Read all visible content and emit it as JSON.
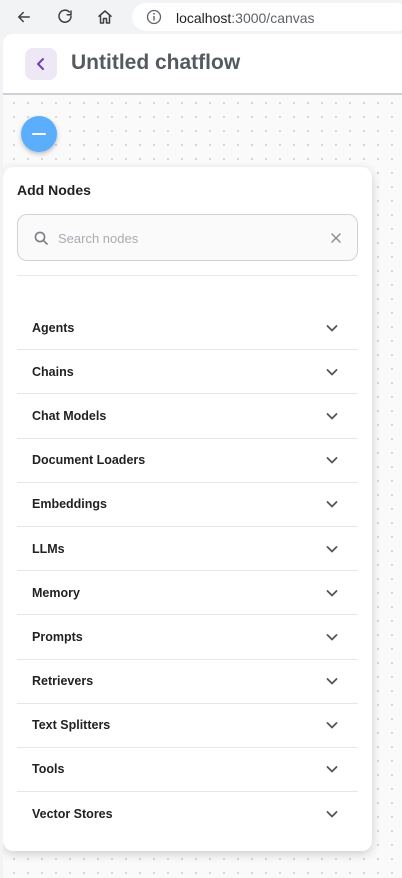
{
  "browser": {
    "url_host": "localhost",
    "url_path": ":3000/canvas"
  },
  "header": {
    "title": "Untitled chatflow"
  },
  "panel": {
    "title": "Add Nodes",
    "search_placeholder": "Search nodes",
    "search_value": "",
    "categories": [
      "Agents",
      "Chains",
      "Chat Models",
      "Document Loaders",
      "Embeddings",
      "LLMs",
      "Memory",
      "Prompts",
      "Retrievers",
      "Text Splitters",
      "Tools",
      "Vector Stores"
    ]
  },
  "icons": {
    "back": "arrow-left-icon",
    "reload": "reload-icon",
    "home": "home-icon",
    "info": "info-icon",
    "chatflow_back": "chevron-left-icon",
    "toggle": "minus-icon",
    "search": "search-icon",
    "clear": "close-icon",
    "expand": "chevron-down-icon"
  },
  "colors": {
    "accent_fab": "#5aaefc",
    "back_button_bg": "#ede7f6",
    "back_button_fg": "#6a3fbf"
  }
}
